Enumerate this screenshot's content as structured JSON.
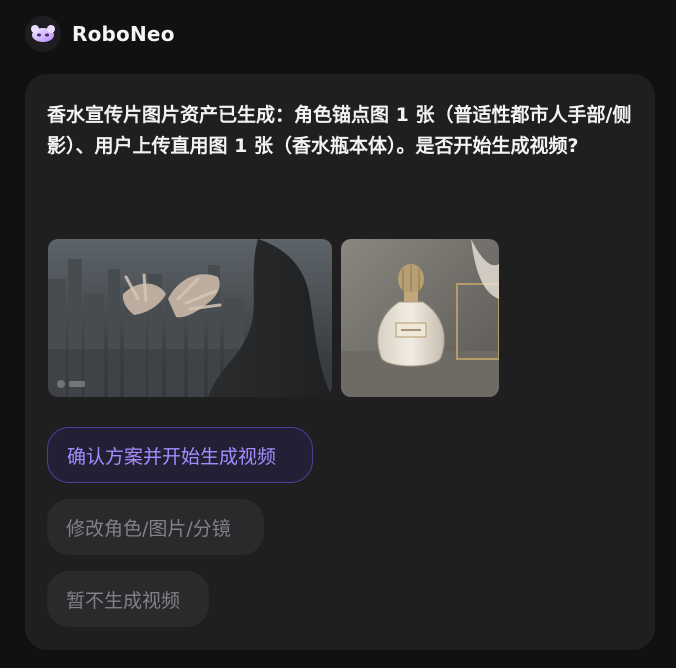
{
  "app": {
    "name": "RoboNeo",
    "avatar_icon": "roboneo-logo-icon"
  },
  "message": {
    "text": "香水宣传片图片资产已生成：角色锚点图 1 张（普适性都市人手部/侧影）、用户上传直用图 1 张（香水瓶本体）。是否开始生成视频?"
  },
  "assets": [
    {
      "name": "character-anchor-image",
      "watermark": "RN"
    },
    {
      "name": "perfume-bottle-image",
      "label": "CAMILLA"
    }
  ],
  "actions": {
    "confirm_label": "确认方案并开始生成视频",
    "edit_label": "修改角色/图片/分镜",
    "skip_label": "暂不生成视频"
  },
  "colors": {
    "page_bg": "#111112",
    "card_bg": "#1f1f20",
    "accent": "#a48cff",
    "accent_border": "#4d3fa0",
    "secondary_bg": "#2a2a2c",
    "secondary_text": "#828286"
  }
}
